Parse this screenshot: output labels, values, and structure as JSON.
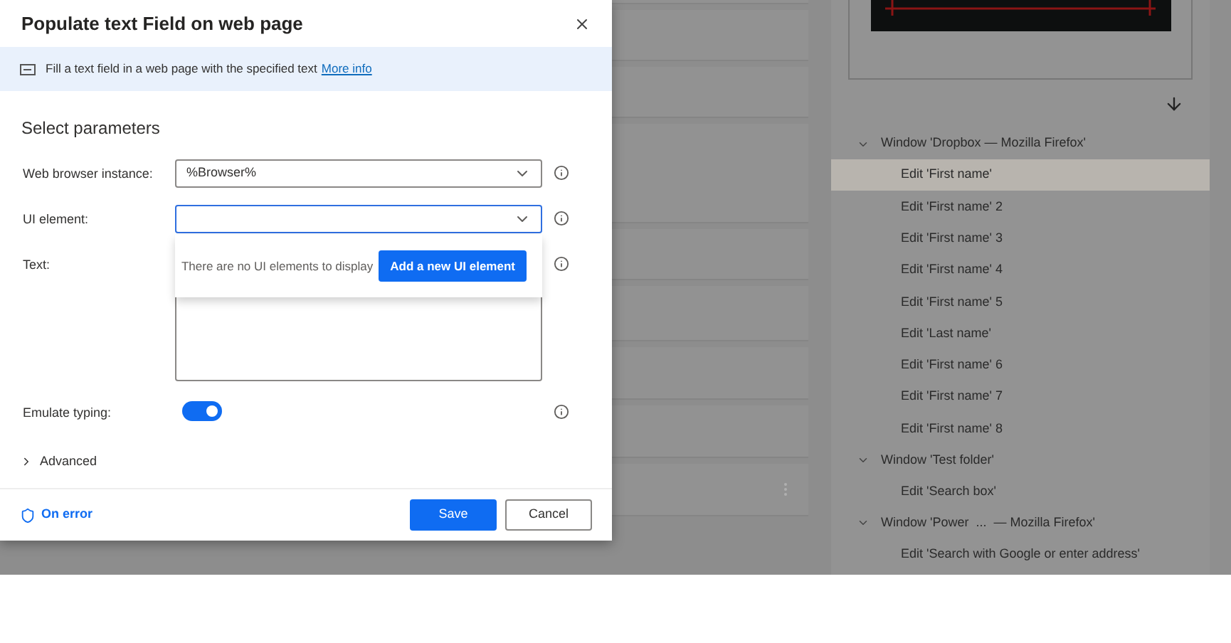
{
  "dialog": {
    "title": "Populate text Field on web page",
    "banner": {
      "text": "Fill a text field in a web page with the specified text",
      "link": "More info"
    },
    "section_title": "Select parameters",
    "fields": [
      {
        "label": "Web browser instance:",
        "kind": "dropdown",
        "value": "%Browser%",
        "focused": false
      },
      {
        "label": "UI element:",
        "kind": "dropdown",
        "focused": true
      },
      {
        "label": "Text:",
        "kind": "textarea"
      },
      {
        "label": "Emulate typing:",
        "kind": "toggle",
        "on": true
      }
    ],
    "popup": {
      "message": "There are no UI elements to display",
      "button": "Add a new UI element"
    },
    "advanced": {
      "label": "Advanced",
      "expanded": false
    },
    "on_error": "On error",
    "buttons": [
      {
        "label": "Save",
        "kind": "primary"
      },
      {
        "label": "Cancel",
        "kind": "secondary"
      }
    ]
  },
  "ui_elements_tree": [
    {
      "label": "Window 'Dropbox — Mozilla Firefox'",
      "expanded": true,
      "children": [
        {
          "label": "Edit 'First name'",
          "selected": true
        },
        {
          "label": "Edit 'First name' 2",
          "selected": false
        },
        {
          "label": "Edit 'First name' 3",
          "selected": false
        },
        {
          "label": "Edit 'First name' 4",
          "selected": false
        },
        {
          "label": "Edit 'First name' 5",
          "selected": false
        },
        {
          "label": "Edit 'Last name'",
          "selected": false
        },
        {
          "label": "Edit 'First name' 6",
          "selected": false
        },
        {
          "label": "Edit 'First name' 7",
          "selected": false
        },
        {
          "label": "Edit 'First name' 8",
          "selected": false
        }
      ]
    },
    {
      "label": "Window 'Test folder'",
      "expanded": true,
      "children": [
        {
          "label": "Edit 'Search box'",
          "selected": false
        }
      ]
    },
    {
      "label": "Window 'Power  ...  — Mozilla Firefox'",
      "expanded": true,
      "children": [
        {
          "label": "Edit 'Search with Google or enter address'",
          "selected": false
        }
      ]
    }
  ]
}
